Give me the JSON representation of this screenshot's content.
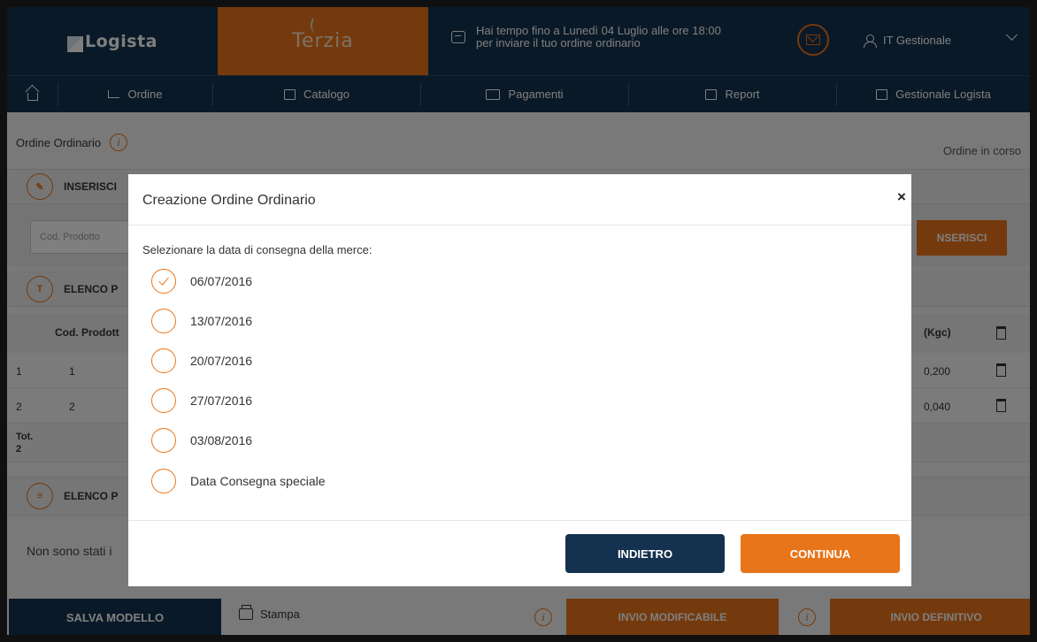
{
  "header": {
    "logo_text": "Logista",
    "brand_text": "Terzia",
    "deadline_line1": "Hai tempo fino a Lunedì 04 Luglio alle ore 18:00",
    "deadline_line2": "per inviare il tuo ordine ordinario",
    "user_name": "IT Gestionale"
  },
  "nav": {
    "items": [
      {
        "label": "Ordine"
      },
      {
        "label": "Catalogo"
      },
      {
        "label": "Pagamenti"
      },
      {
        "label": "Report"
      },
      {
        "label": "Gestionale Logista"
      }
    ]
  },
  "page": {
    "title": "Ordine Ordinario",
    "status": "Ordine in corso",
    "section_insert": "INSERISCI",
    "product_code_placeholder": "Cod. Prodotto",
    "insert_button": "NSERISCI",
    "section_list1": "ELENCO P",
    "section_list2": "ELENCO P",
    "table_col_code": "Cod. Prodott",
    "table_col_weight": "(Kgc)",
    "rows": [
      {
        "index": "1",
        "code": "1",
        "weight": "0,200"
      },
      {
        "index": "2",
        "code": "2",
        "weight": "0,040"
      }
    ],
    "total_label": "Tot.",
    "total_value": "2",
    "empty_message": "Non sono stati i",
    "save_model_button": "SALVA MODELLO",
    "print_label": "Stampa",
    "send_editable_button": "INVIO MODIFICABILE",
    "send_final_button": "INVIO DEFINITIVO"
  },
  "modal": {
    "title": "Creazione Ordine Ordinario",
    "close": "×",
    "prompt": "Selezionare la data di consegna della merce:",
    "options": [
      {
        "label": "06/07/2016",
        "checked": true
      },
      {
        "label": "13/07/2016",
        "checked": false
      },
      {
        "label": "20/07/2016",
        "checked": false
      },
      {
        "label": "27/07/2016",
        "checked": false
      },
      {
        "label": "03/08/2016",
        "checked": false
      },
      {
        "label": "Data Consegna speciale",
        "checked": false
      }
    ],
    "back_button": "INDIETRO",
    "continue_button": "CONTINUA"
  },
  "colors": {
    "navy": "#14324f",
    "orange": "#e8751a"
  }
}
